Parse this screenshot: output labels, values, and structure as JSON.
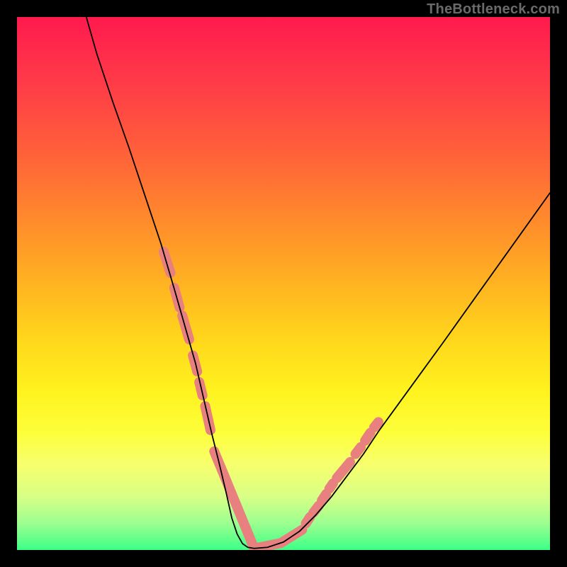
{
  "watermark": "TheBottleneck.com",
  "colors": {
    "frame": "#000000",
    "gradient_top": "#ff1a4e",
    "gradient_bottom": "#3dff87",
    "curve": "#000000",
    "markers": "#e98080",
    "watermark": "#6a6a6a"
  },
  "chart_data": {
    "type": "line",
    "title": "",
    "xlabel": "",
    "ylabel": "",
    "xlim": [
      0,
      100
    ],
    "ylim": [
      0,
      100
    ],
    "series": [
      {
        "name": "bottleneck-curve",
        "x": [
          13,
          15,
          18,
          21,
          24,
          27,
          29.5,
          31.5,
          33.5,
          35,
          36.5,
          38,
          39.3,
          40.3,
          41.3,
          42.3,
          43.3,
          44.5,
          47,
          50,
          53,
          56,
          59,
          62,
          65,
          68,
          72,
          76,
          80,
          85,
          90,
          95,
          100
        ],
        "values": [
          100,
          93,
          84,
          75.5,
          66.5,
          57.5,
          49,
          42,
          35,
          28.5,
          22,
          16,
          10.5,
          6,
          3,
          1.2,
          0.5,
          0.3,
          0.5,
          1.5,
          3.5,
          6.5,
          10,
          14,
          18,
          22.5,
          28,
          33.5,
          39,
          46,
          53,
          60,
          67
        ]
      }
    ],
    "markers": {
      "name": "highlight-segments",
      "segments": [
        {
          "x": [
            27.5,
            28.8
          ],
          "values": [
            56,
            52
          ]
        },
        {
          "x": [
            29.5,
            30.5
          ],
          "values": [
            49.2,
            45.5
          ]
        },
        {
          "x": [
            31.0,
            32.3
          ],
          "values": [
            44,
            39.5
          ]
        },
        {
          "x": [
            33.0,
            33.8
          ],
          "values": [
            36.5,
            33.5
          ]
        },
        {
          "x": [
            34.2,
            34.8
          ],
          "values": [
            31.5,
            29
          ]
        },
        {
          "x": [
            35.3,
            36.3
          ],
          "values": [
            27,
            22.5
          ]
        },
        {
          "x": [
            37.0,
            44.5
          ],
          "values": [
            18.5,
            0.3
          ]
        },
        {
          "x": [
            44.5,
            49.5
          ],
          "values": [
            0.3,
            1.3
          ]
        },
        {
          "x": [
            49.5,
            53.5
          ],
          "values": [
            1.3,
            3.8
          ]
        },
        {
          "x": [
            54.2,
            55.0
          ],
          "values": [
            5.0,
            6.2
          ]
        },
        {
          "x": [
            55.6,
            56.6
          ],
          "values": [
            7.0,
            8.3
          ]
        },
        {
          "x": [
            57.2,
            58.0
          ],
          "values": [
            9.3,
            10.5
          ]
        },
        {
          "x": [
            58.6,
            59.3
          ],
          "values": [
            11.5,
            12.5
          ]
        },
        {
          "x": [
            60.0,
            62.5
          ],
          "values": [
            13.5,
            16.5
          ]
        },
        {
          "x": [
            63.5,
            64.5
          ],
          "values": [
            18.0,
            19.3
          ]
        },
        {
          "x": [
            65.3,
            66.3
          ],
          "values": [
            20.5,
            22.0
          ]
        },
        {
          "x": [
            67.0,
            67.8
          ],
          "values": [
            23.0,
            24.0
          ]
        }
      ]
    }
  }
}
